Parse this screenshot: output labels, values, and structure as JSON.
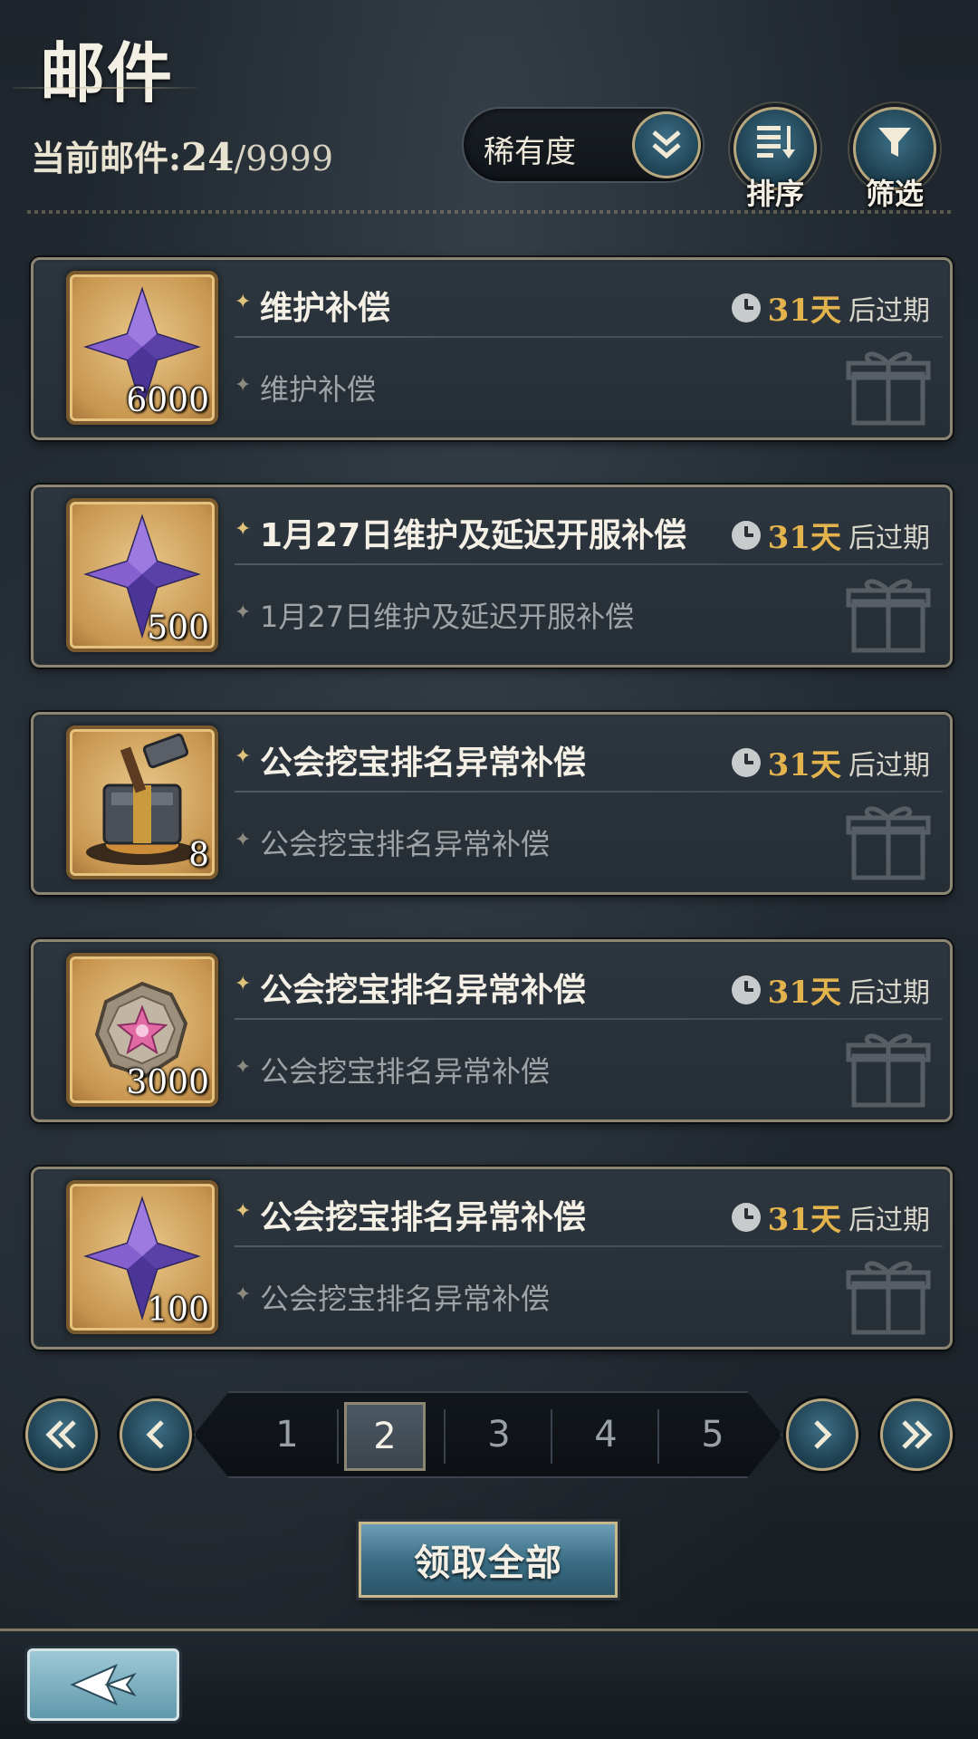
{
  "header": {
    "title": "邮件",
    "count_label": "当前邮件:",
    "count_current": "24",
    "count_max": "/9999"
  },
  "toolbar": {
    "rarity_selected": "稀有度",
    "sort_label": "排序",
    "filter_label": "筛选"
  },
  "mails": [
    {
      "title": "维护补偿",
      "subtitle": "维护补偿",
      "item": "purple-crystal",
      "quantity": "6000",
      "expiry_days": "31天",
      "expiry_suffix": "后过期"
    },
    {
      "title": "1月27日维护及延迟开服补偿",
      "subtitle": "1月27日维护及延迟开服补偿",
      "item": "purple-crystal",
      "quantity": "500",
      "expiry_days": "31天",
      "expiry_suffix": "后过期"
    },
    {
      "title": "公会挖宝排名异常补偿",
      "subtitle": "公会挖宝排名异常补偿",
      "item": "forge-hammer",
      "quantity": "8",
      "expiry_days": "31天",
      "expiry_suffix": "后过期"
    },
    {
      "title": "公会挖宝排名异常补偿",
      "subtitle": "公会挖宝排名异常补偿",
      "item": "star-medal",
      "quantity": "3000",
      "expiry_days": "31天",
      "expiry_suffix": "后过期"
    },
    {
      "title": "公会挖宝排名异常补偿",
      "subtitle": "公会挖宝排名异常补偿",
      "item": "purple-crystal",
      "quantity": "100",
      "expiry_days": "31天",
      "expiry_suffix": "后过期"
    }
  ],
  "pagination": {
    "pages": [
      "1",
      "2",
      "3",
      "4",
      "5"
    ],
    "current": "2"
  },
  "actions": {
    "claim_all_label": "领取全部"
  },
  "icons": {
    "first": "double-chevron-left-icon",
    "prev": "chevron-left-icon",
    "next": "chevron-right-icon",
    "last": "double-chevron-right-icon",
    "back": "back-arrow-icon",
    "clock": "clock-icon",
    "gift": "gift-icon"
  },
  "colors": {
    "accent_gold": "#e3b34d",
    "button_blue": "#386b82"
  }
}
